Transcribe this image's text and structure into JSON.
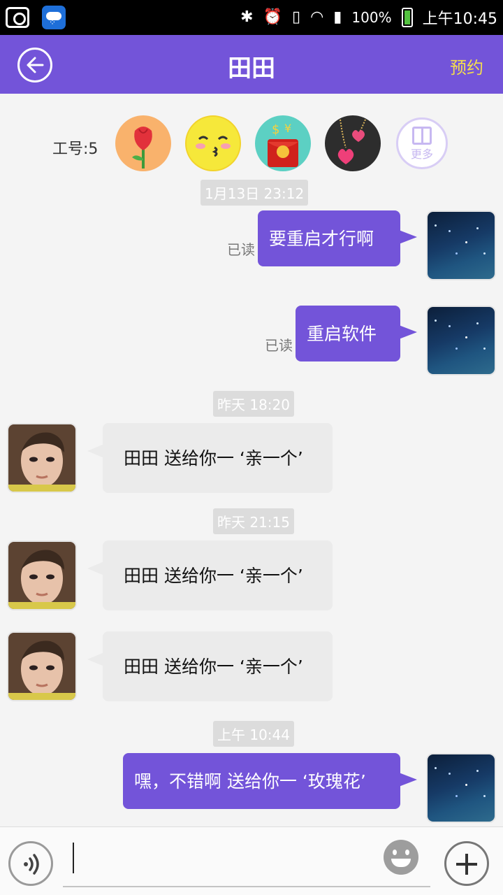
{
  "status_bar": {
    "battery": "100%",
    "time": "上午10:45"
  },
  "header": {
    "title": "田田",
    "right_action": "预约"
  },
  "gift_bar": {
    "staff_label": "工号:5",
    "gifts": [
      "rose-icon",
      "kiss-face-icon",
      "red-envelope-icon",
      "heart-necklace-icon"
    ],
    "more_label": "更多"
  },
  "messages": [
    {
      "type": "timestamp",
      "text": "1月13日 23:12"
    },
    {
      "type": "outgoing",
      "text": "要重启才行啊",
      "status": "已读"
    },
    {
      "type": "outgoing",
      "text": "重启软件",
      "status": "已读"
    },
    {
      "type": "timestamp",
      "text": "昨天 18:20"
    },
    {
      "type": "incoming",
      "text": "田田  送给你一 ‘亲一个’"
    },
    {
      "type": "timestamp",
      "text": "昨天 21:15"
    },
    {
      "type": "incoming",
      "text": "田田  送给你一 ‘亲一个’"
    },
    {
      "type": "incoming",
      "text": "田田  送给你一 ‘亲一个’"
    },
    {
      "type": "timestamp",
      "text": "上午 10:44"
    },
    {
      "type": "outgoing",
      "text": "嘿，不错啊  送给你一 ‘玫瑰花’"
    }
  ],
  "input_bar": {
    "placeholder": ""
  }
}
